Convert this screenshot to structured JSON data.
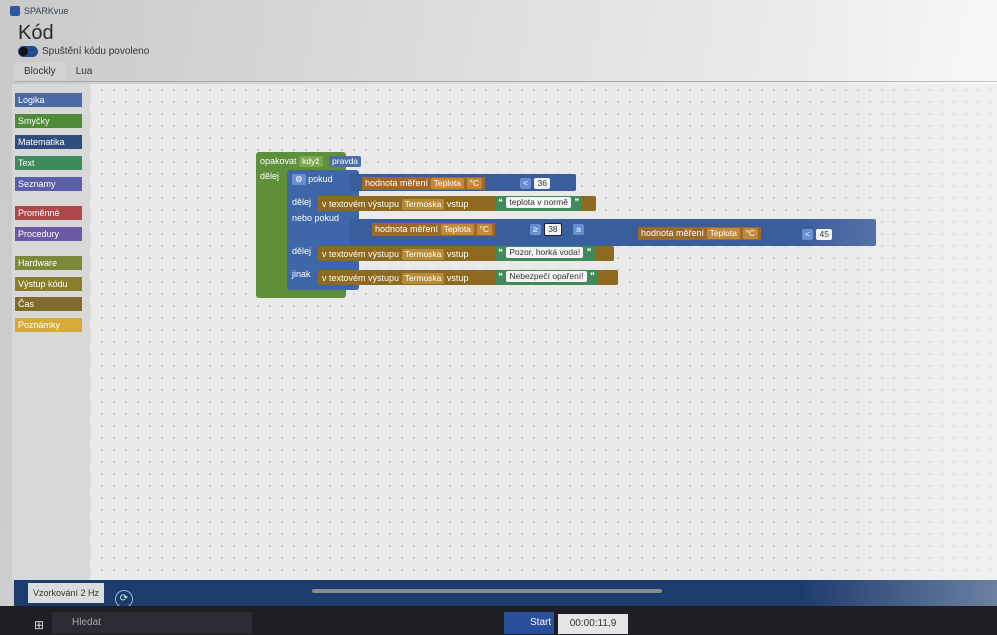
{
  "app": {
    "name": "SPARKvue",
    "page_title": "Kód",
    "toggle_label": "Spuštění kódu povoleno"
  },
  "tabs": [
    "Blockly",
    "Lua"
  ],
  "toolbox": [
    {
      "label": "Logika",
      "color": "#4a6aa3"
    },
    {
      "label": "Smyčky",
      "color": "#4f8a3a"
    },
    {
      "label": "Matematika",
      "color": "#2f4e7d"
    },
    {
      "label": "Text",
      "color": "#3f8a5a"
    },
    {
      "label": "Seznamy",
      "color": "#5b5fa8"
    },
    {
      "label": "Proměnné",
      "color": "#b0474a"
    },
    {
      "label": "Procedury",
      "color": "#6b5aa3"
    },
    {
      "label": "Hardware",
      "color": "#7b8a3a"
    },
    {
      "label": "Výstup kódu",
      "color": "#8a7d2e"
    },
    {
      "label": "Čas",
      "color": "#806a2c"
    },
    {
      "label": "Poznámky",
      "color": "#d7a935"
    }
  ],
  "code": {
    "loop": {
      "label": "opakovat",
      "mode": "když",
      "condition": "pravda",
      "do_label": "dělej"
    },
    "if": {
      "label": "pokud",
      "measure_label": "hodnota měření",
      "sensor": "Teplota",
      "unit": "°C",
      "op": "<",
      "value": "36"
    },
    "do1": {
      "label": "dělej",
      "output": "v textovém výstupu",
      "target": "Termoska",
      "input": "vstup",
      "text": "teplota v normě"
    },
    "elseif": {
      "label": "nebo pokud",
      "measure_label": "hodnota měření",
      "sensor": "Teplota",
      "unit": "°C",
      "op1": "≥",
      "value1": "38",
      "and": "a",
      "measure_label2": "hodnota měření",
      "sensor2": "Teplota",
      "unit2": "°C",
      "op2": "<",
      "value2": "45"
    },
    "do2": {
      "label": "dělej",
      "output": "v textovém výstupu",
      "target": "Termoska",
      "input": "vstup",
      "text": "Pozor, horká voda!"
    },
    "else": {
      "label": "jinak",
      "output": "v textovém výstupu",
      "target": "Termoska",
      "input": "vstup",
      "text": "Nebezpečí opaření!"
    }
  },
  "bottom": {
    "sampling": "Vzorkování 2 Hz",
    "start": "Start",
    "time": "00:00:11,9"
  },
  "taskbar": {
    "search": "Hledat"
  }
}
